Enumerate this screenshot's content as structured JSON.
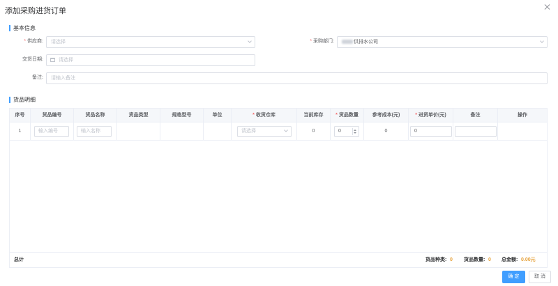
{
  "dialog": {
    "title": "添加采购进货订单"
  },
  "basic": {
    "section_title": "基本信息",
    "supplier": {
      "label": "供应商:",
      "placeholder": "请选择"
    },
    "department": {
      "label": "采购部门:",
      "value": "供排水公司"
    },
    "delivery_date": {
      "label": "交货日期:",
      "placeholder": "请选择"
    },
    "remark": {
      "label": "备注:",
      "placeholder": "请输入备注"
    }
  },
  "goods": {
    "section_title": "货品明细",
    "columns": [
      "序号",
      "货品编号",
      "货品名称",
      "货品类型",
      "规格型号",
      "单位",
      "收货仓库",
      "当前库存",
      "货品数量",
      "参考成本(元)",
      "进货单价(元)",
      "备注",
      "操作"
    ],
    "rows": [
      {
        "index": "1",
        "code_placeholder": "输入编号",
        "name_placeholder": "输入名称",
        "warehouse_placeholder": "请选择",
        "stock": "0",
        "quantity": "0",
        "cost": "0",
        "unit_price": "0"
      }
    ],
    "footer": {
      "total_label": "总计",
      "kinds_label": "货品种类:",
      "kinds_value": "0",
      "count_label": "货品数量:",
      "count_value": "0",
      "amount_label": "总金额:",
      "amount_value": "0.00元"
    }
  },
  "buttons": {
    "confirm": "确 定",
    "cancel": "取 消"
  },
  "colors": {
    "accent": "#409eff",
    "required": "#f56c6c",
    "amount": "#e6a23c"
  }
}
